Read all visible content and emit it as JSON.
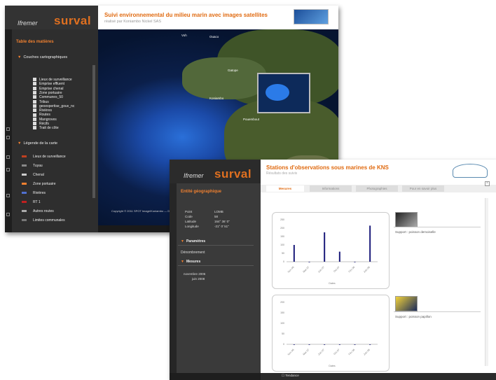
{
  "window1": {
    "brand_small": "Ifremer",
    "brand_big": "surval",
    "title": "Suivi environnemental du milieu marin avec images satellites",
    "subtitle": "réalisé par Koniambo Nickel SAS",
    "toc_title": "Table des matières",
    "section_layers": "Couches cartographiques",
    "layers": [
      "Lieux de surveillance",
      "Emprise effluent",
      "Emprise chenal",
      "Zone portuaire",
      "Communes_50",
      "Tribus",
      "geoexpertise_gouv_nc",
      "Rivières",
      "Routes",
      "Mangroves",
      "Récifs",
      "Trait de côte"
    ],
    "section_legend": "Légende de la carte",
    "legend": [
      "Lieux de surveillance",
      "Tuyau",
      "Chenal",
      "Zone portuaire",
      "Rivières",
      "RT 1",
      "Autres routes",
      "Limites communales"
    ],
    "map_labels": [
      "Voh",
      "Ouaco",
      "Gatope",
      "Koniambo",
      "Pouembout"
    ],
    "copyright": "Copyright © 2011 SPOT Image/Koniambo — DTSI Gouvernement de la Nouvelle-Calédonie"
  },
  "window2": {
    "brand_small": "Ifremer",
    "brand_big": "surval",
    "title": "Stations d'observations sous marines de KNS",
    "subtitle": "Résultats des suivis",
    "section_entity": "Entité géographique",
    "fields": [
      {
        "label": "Point",
        "value": "LOMB"
      },
      {
        "label": "Code",
        "value": "58"
      },
      {
        "label": "Latitude",
        "value": "164° 36' 0\""
      },
      {
        "label": "Longitude",
        "value": "-21° 0' 51\""
      }
    ],
    "section_params": "Paramètres",
    "param_value": "Dénombrement",
    "section_mesures": "Mesures",
    "dates": [
      "novembre 2006",
      "juin 2008"
    ],
    "tabs": [
      "Mesures",
      "Informations",
      "Photographies",
      "Pour en savoir plus"
    ],
    "supports": [
      "Support : poisson demoiselle",
      "Support : poisson papillon"
    ],
    "footer_label": "Tendance"
  },
  "chart_data": [
    {
      "type": "bar",
      "categories": [
        "Nov 06",
        "Mar 07",
        "Juin 07",
        "Oct 07",
        "Fév 08",
        "Juin 08"
      ],
      "values": [
        100,
        0,
        175,
        60,
        0,
        215
      ],
      "ylim": [
        0,
        250
      ],
      "yticks": [
        0,
        50,
        100,
        150,
        200,
        250
      ],
      "xlabel": "Dates",
      "color": "#1a1a7a"
    },
    {
      "type": "bar",
      "categories": [
        "Nov 06",
        "Mar 07",
        "Juin 07",
        "Oct 07",
        "Fév 08",
        "Juin 08"
      ],
      "values": [
        0,
        0,
        0,
        0,
        0,
        0
      ],
      "ylim": [
        0,
        200
      ],
      "yticks": [
        0,
        50,
        100,
        150,
        200
      ],
      "xlabel": "Dates",
      "color": "#1a1a7a"
    }
  ]
}
